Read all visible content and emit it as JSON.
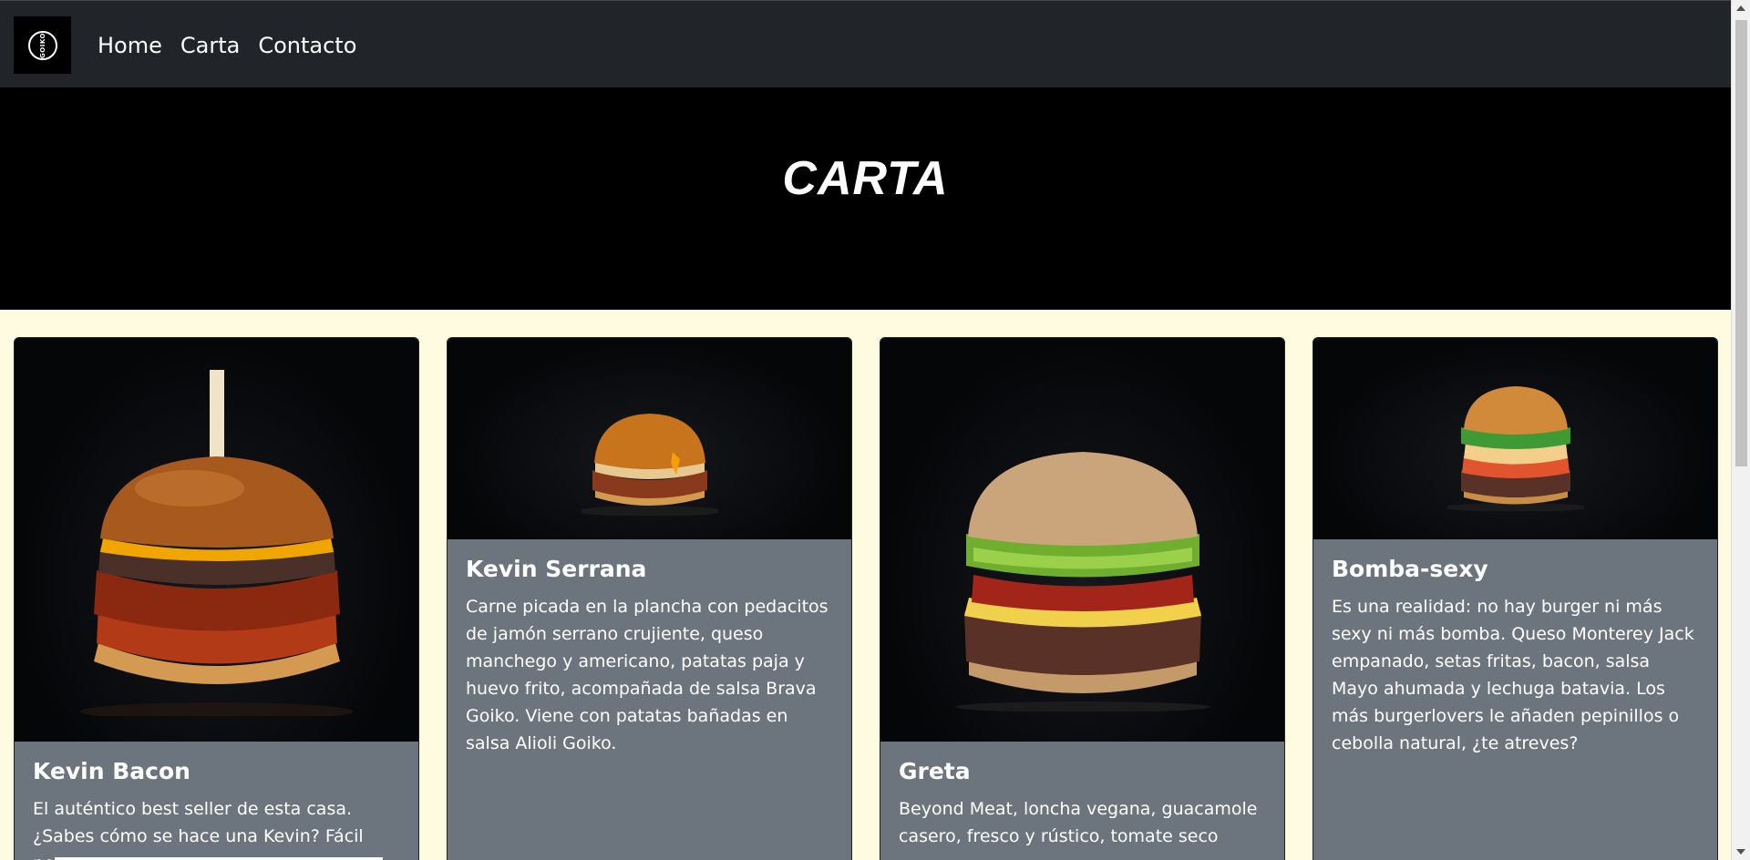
{
  "nav": {
    "logo_text": "GOIKO",
    "links": [
      "Home",
      "Carta",
      "Contacto"
    ]
  },
  "hero": {
    "title": "CARTA"
  },
  "cards": [
    {
      "title": "Kevin Bacon",
      "text": "El auténtico best seller de esta casa. ¿Sabes cómo se hace una Kevin? Fácil pero",
      "image_icon": "burger-image"
    },
    {
      "title": "Kevin Serrana",
      "text": "Carne picada en la plancha con pedacitos de jamón serrano crujiente, queso manchego y americano, patatas paja y huevo frito, acompañada de salsa Brava Goiko. Viene con patatas bañadas en salsa Alioli Goiko.",
      "image_icon": "burger-image"
    },
    {
      "title": "Greta",
      "text": "Beyond Meat, loncha vegana, guacamole casero, fresco y rústico, tomate seco",
      "image_icon": "burger-image"
    },
    {
      "title": "Bomba-sexy",
      "text": "Es una realidad: no hay burger ni más sexy ni más bomba. Queso Monterey Jack empanado, setas fritas, bacon, salsa Mayo ahumada y lechuga batavia. Los más burgerlovers le añaden pepinillos o cebolla natural, ¿te atreves?",
      "image_icon": "burger-image"
    }
  ],
  "colors": {
    "navbar": "#212529",
    "hero": "#000000",
    "page_bg": "#fffbe0",
    "card_bg": "#6c757d"
  }
}
